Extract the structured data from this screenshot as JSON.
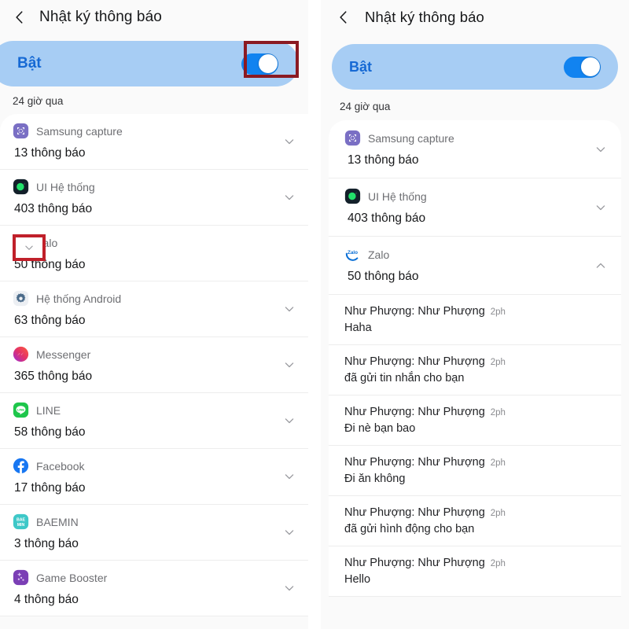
{
  "colors": {
    "pill_bg": "#a7cdf4",
    "pill_text": "#1669d4",
    "switch_on": "#1183f0",
    "anno_toggle_border": "#8b1a22",
    "anno_chevron_border": "#c0202a",
    "panel_bg": "#fafafa",
    "card_bg": "#ffffff",
    "divider": "#ededed"
  },
  "left": {
    "header": {
      "title": "Nhật ký thông báo",
      "back_icon": "chevron-left-icon"
    },
    "master_toggle": {
      "label": "Bật",
      "state": "on",
      "annotated": true
    },
    "section_label": "24 giờ qua",
    "apps": [
      {
        "name": "Samsung capture",
        "count": "13 thông báo",
        "icon": "samsung-capture-icon",
        "chevron": "chevron-down-icon",
        "annotated": false
      },
      {
        "name": "UI Hệ thống",
        "count": "403 thông báo",
        "icon": "system-ui-icon",
        "chevron": "chevron-down-icon",
        "annotated": false
      },
      {
        "name": "Zalo",
        "count": "50 thông báo",
        "icon": "zalo-icon",
        "chevron": "chevron-down-icon",
        "annotated": true
      },
      {
        "name": "Hệ thống Android",
        "count": "63 thông báo",
        "icon": "android-system-icon",
        "chevron": "chevron-down-icon",
        "annotated": false
      },
      {
        "name": "Messenger",
        "count": "365 thông báo",
        "icon": "messenger-icon",
        "chevron": "chevron-down-icon",
        "annotated": false
      },
      {
        "name": "LINE",
        "count": "58 thông báo",
        "icon": "line-icon",
        "chevron": "chevron-down-icon",
        "annotated": false
      },
      {
        "name": "Facebook",
        "count": "17 thông báo",
        "icon": "facebook-icon",
        "chevron": "chevron-down-icon",
        "annotated": false
      },
      {
        "name": "BAEMIN",
        "count": "3 thông báo",
        "icon": "baemin-icon",
        "chevron": "chevron-down-icon",
        "annotated": false
      },
      {
        "name": "Game Booster",
        "count": "4 thông báo",
        "icon": "game-booster-icon",
        "chevron": "chevron-down-icon",
        "annotated": false
      }
    ]
  },
  "right": {
    "header": {
      "title": "Nhật ký thông báo",
      "back_icon": "chevron-left-icon"
    },
    "master_toggle": {
      "label": "Bật",
      "state": "on"
    },
    "section_label": "24 giờ qua",
    "apps": [
      {
        "name": "Samsung capture",
        "count": "13 thông báo",
        "icon": "samsung-capture-icon",
        "chevron": "chevron-down-icon"
      },
      {
        "name": "UI Hệ thống",
        "count": "403 thông báo",
        "icon": "system-ui-icon",
        "chevron": "chevron-down-icon"
      },
      {
        "name": "Zalo",
        "count": "50 thông báo",
        "icon": "zalo-icon",
        "chevron": "chevron-up-icon"
      }
    ],
    "notifications": [
      {
        "title": "Như Phượng: Như Phượng",
        "time": "2ph",
        "body": "Haha"
      },
      {
        "title": "Như Phượng: Như Phượng",
        "time": "2ph",
        "body": "đã gửi tin nhắn cho bạn"
      },
      {
        "title": "Như Phượng: Như Phượng",
        "time": "2ph",
        "body": "Đi nè bạn bao"
      },
      {
        "title": "Như Phượng: Như Phượng",
        "time": "2ph",
        "body": "Đi ăn không"
      },
      {
        "title": "Như Phượng: Như Phượng",
        "time": "2ph",
        "body": "đã gửi hình động cho bạn"
      },
      {
        "title": "Như Phượng: Như Phượng",
        "time": "2ph",
        "body": "Hello"
      }
    ]
  }
}
